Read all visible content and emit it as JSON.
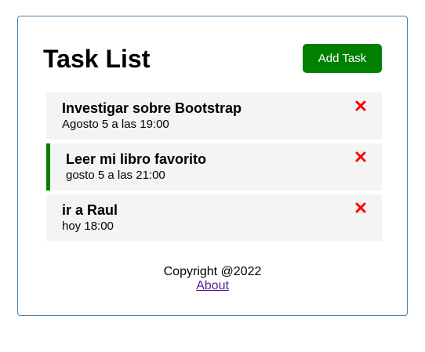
{
  "header": {
    "title": "Task List",
    "add_button_label": "Add Task"
  },
  "tasks": [
    {
      "text": "Investigar sobre Bootstrap",
      "day": "Agosto 5 a las 19:00",
      "reminder": false,
      "delete_icon": "close-x-icon"
    },
    {
      "text": "Leer mi libro favorito",
      "day": "gosto 5 a las 21:00",
      "reminder": true,
      "delete_icon": "close-x-icon"
    },
    {
      "text": "ir a Raul",
      "day": "hoy 18:00",
      "reminder": false,
      "delete_icon": "close-x-icon"
    }
  ],
  "footer": {
    "copyright": "Copyright @2022",
    "about_link": "About"
  },
  "colors": {
    "accent": "#008000",
    "delete": "#ff0000",
    "border": "#4682b4",
    "task_bg": "#f4f4f4",
    "link": "#551a8b"
  }
}
